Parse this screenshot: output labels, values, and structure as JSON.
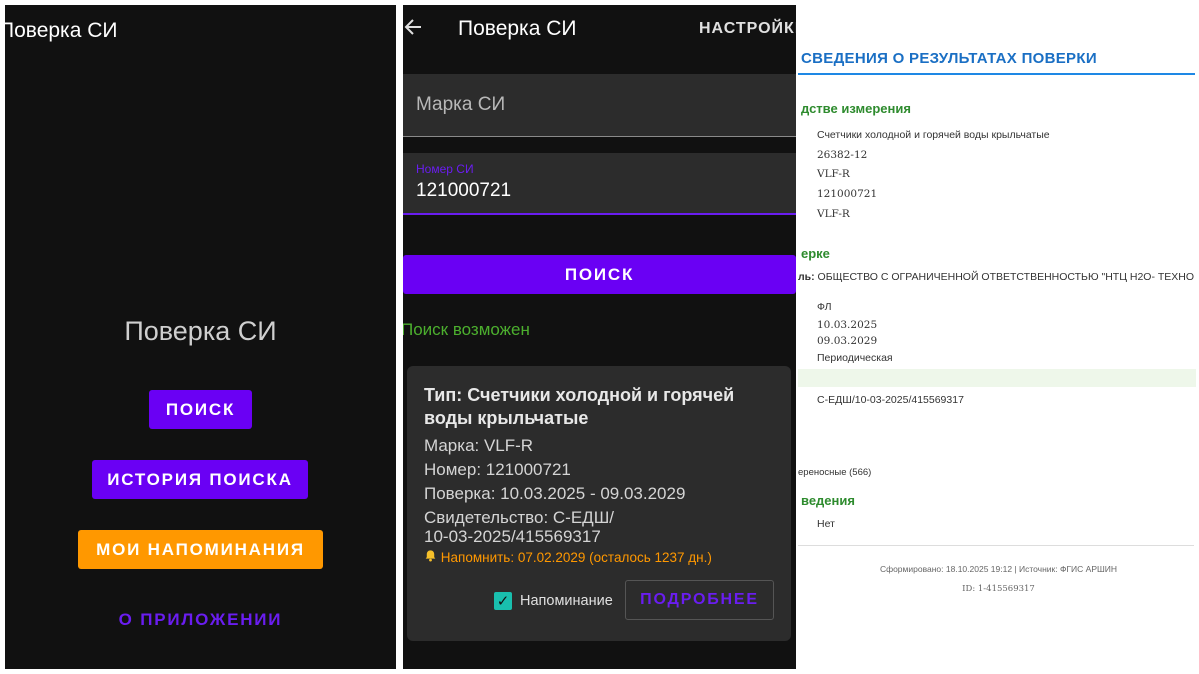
{
  "panel1": {
    "appbar_title": "Поверка СИ",
    "center_title": "Поверка СИ",
    "buttons": {
      "search": "ПОИСК",
      "history": "ИСТОРИЯ ПОИСКА",
      "reminders": "МОИ НАПОМИНАНИЯ",
      "about": "О ПРИЛОЖЕНИИ"
    },
    "colors": {
      "primary": "#6a00f4",
      "accent": "#ff9800",
      "background": "#111111"
    }
  },
  "panel2": {
    "back_icon": "arrow-left-icon",
    "title": "Поверка СИ",
    "settings": "НАСТРОЙКИ",
    "brand_field": {
      "placeholder": "Марка СИ"
    },
    "number_field": {
      "label": "Номер СИ",
      "value": "121000721"
    },
    "search_button": "ПОИСК",
    "status": "Поиск возможен",
    "result_card": {
      "type": "Тип: Счетчики холодной и горячей воды крыльчатые",
      "brand": "Марка: VLF-R",
      "number": "Номер: 121000721",
      "verification": "Поверка: 10.03.2025 - 09.03.2029",
      "certificate_line1": "Свидетельство: С-ЕДШ/",
      "certificate_line2": "10-03-2025/415569317",
      "reminder_icon": "bell-icon",
      "reminder": "Напомнить: 07.02.2029 (осталось 1237 дн.)",
      "reminder_checkbox_label": "Напоминание",
      "reminder_checked": true,
      "details_button": "ПОДРОБНЕЕ"
    }
  },
  "panel3": {
    "header": "СВЕДЕНИЯ О РЕЗУЛЬТАТАХ ПОВЕРКИ",
    "section_instrument": "дстве измерения",
    "instrument_lines": [
      "Счетчики холодной и горячей воды крыльчатые",
      "26382-12",
      "VLF-R",
      "121000721",
      "VLF-R"
    ],
    "section_verification": "ерке",
    "owner_prefix": "ль:",
    "owner": "ОБЩЕСТВО С ОГРАНИЧЕННОЙ ОТВЕТСТВЕННОСТЬЮ \"НТЦ Н2О- ТЕХНО",
    "verification_lines": [
      "ФЛ",
      "10.03.2025",
      "09.03.2029",
      "Периодическая"
    ],
    "certificate": "С-ЕДШ/10-03-2025/415569317",
    "portable": "ереносные (566)",
    "section_extra": "ведения",
    "extra_value": "Нет",
    "footer_generated": "Сформировано: 18.10.2025 19:12 | Источник: ФГИС АРШИН",
    "footer_id": "ID: 1-415569317"
  }
}
